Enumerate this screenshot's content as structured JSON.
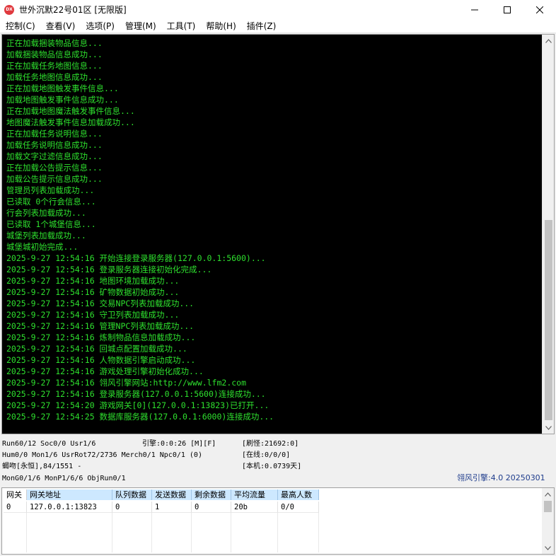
{
  "window": {
    "icon_text": "DX",
    "title": "世外沉默22号01区 [无限版]"
  },
  "menu": [
    "控制(C)",
    "查看(V)",
    "选项(P)",
    "管理(M)",
    "工具(T)",
    "帮助(H)",
    "插件(Z)"
  ],
  "console": {
    "lines": [
      "正在加载捆装物品信息...",
      "加载捆装物品信息成功...",
      "正在加载任务地图信息...",
      "加载任务地图信息成功...",
      "正在加载地图触发事件信息...",
      "加载地图触发事件信息成功...",
      "正在加载地图魔法触发事件信息...",
      "地图魔法触发事件信息加载成功...",
      "正在加载任务说明信息...",
      "加载任务说明信息成功...",
      "加载文字过滤信息成功...",
      "正在加载公告提示信息...",
      "加载公告提示信息成功...",
      "管理员列表加载成功...",
      "已读取 0个行会信息...",
      "行会列表加载成功...",
      "已读取 1个城堡信息...",
      "城堡列表加载成功...",
      "城堡城初始完成...",
      "2025-9-27 12:54:16 开始连接登录服务器(127.0.0.1:5600)...",
      "2025-9-27 12:54:16 登录服务器连接初始化完成...",
      "2025-9-27 12:54:16 地图环境加载成功...",
      "2025-9-27 12:54:16 矿物数据初始成功...",
      "2025-9-27 12:54:16 交易NPC列表加载成功...",
      "2025-9-27 12:54:16 守卫列表加载成功...",
      "2025-9-27 12:54:16 管理NPC列表加载成功...",
      "2025-9-27 12:54:16 炼制物品信息加载成功...",
      "2025-9-27 12:54:16 回城点配置加载成功...",
      "2025-9-27 12:54:16 人物数据引擎启动成功...",
      "2025-9-27 12:54:16 游戏处理引擎初始化成功...",
      "2025-9-27 12:54:16 翎风引擎网站:http://www.lfm2.com",
      "2025-9-27 12:54:16 登录服务器(127.0.0.1:5600)连接成功...",
      "2025-9-27 12:54:20 游戏网关[0](127.0.0.1:13823)已打开...",
      "2025-9-27 12:54:25 数据库服务器(127.0.0.1:6000)连接成功..."
    ]
  },
  "status": {
    "line1_left": "Run60/12 Soc0/0 Usr1/6",
    "line1_mid": "引擎:0:0:26 [M][F]",
    "line1_right": "[刷怪:21692:0]",
    "line2_left": "Hum0/0 Mon1/6 UsrRot72/2736 Merch0/1 Npc0/1 (0)",
    "line2_right": "[在线:0/0/0]",
    "line3_left": "蝎吻[永恒],84/1551 -",
    "line3_right": "[本机:0.0739天]",
    "line4_left": "MonG0/1/6 MonP1/6/6 ObjRun0/1",
    "engine_version": "翎风引擎:4.0 20250301"
  },
  "gateway_table": {
    "headers": [
      "网关",
      "网关地址",
      "队列数据",
      "发送数据",
      "剩余数据",
      "平均流量",
      "最高人数"
    ],
    "rows": [
      [
        "0",
        "127.0.0.1:13823",
        "0",
        "1",
        "0",
        "20b",
        "0/0"
      ]
    ]
  }
}
